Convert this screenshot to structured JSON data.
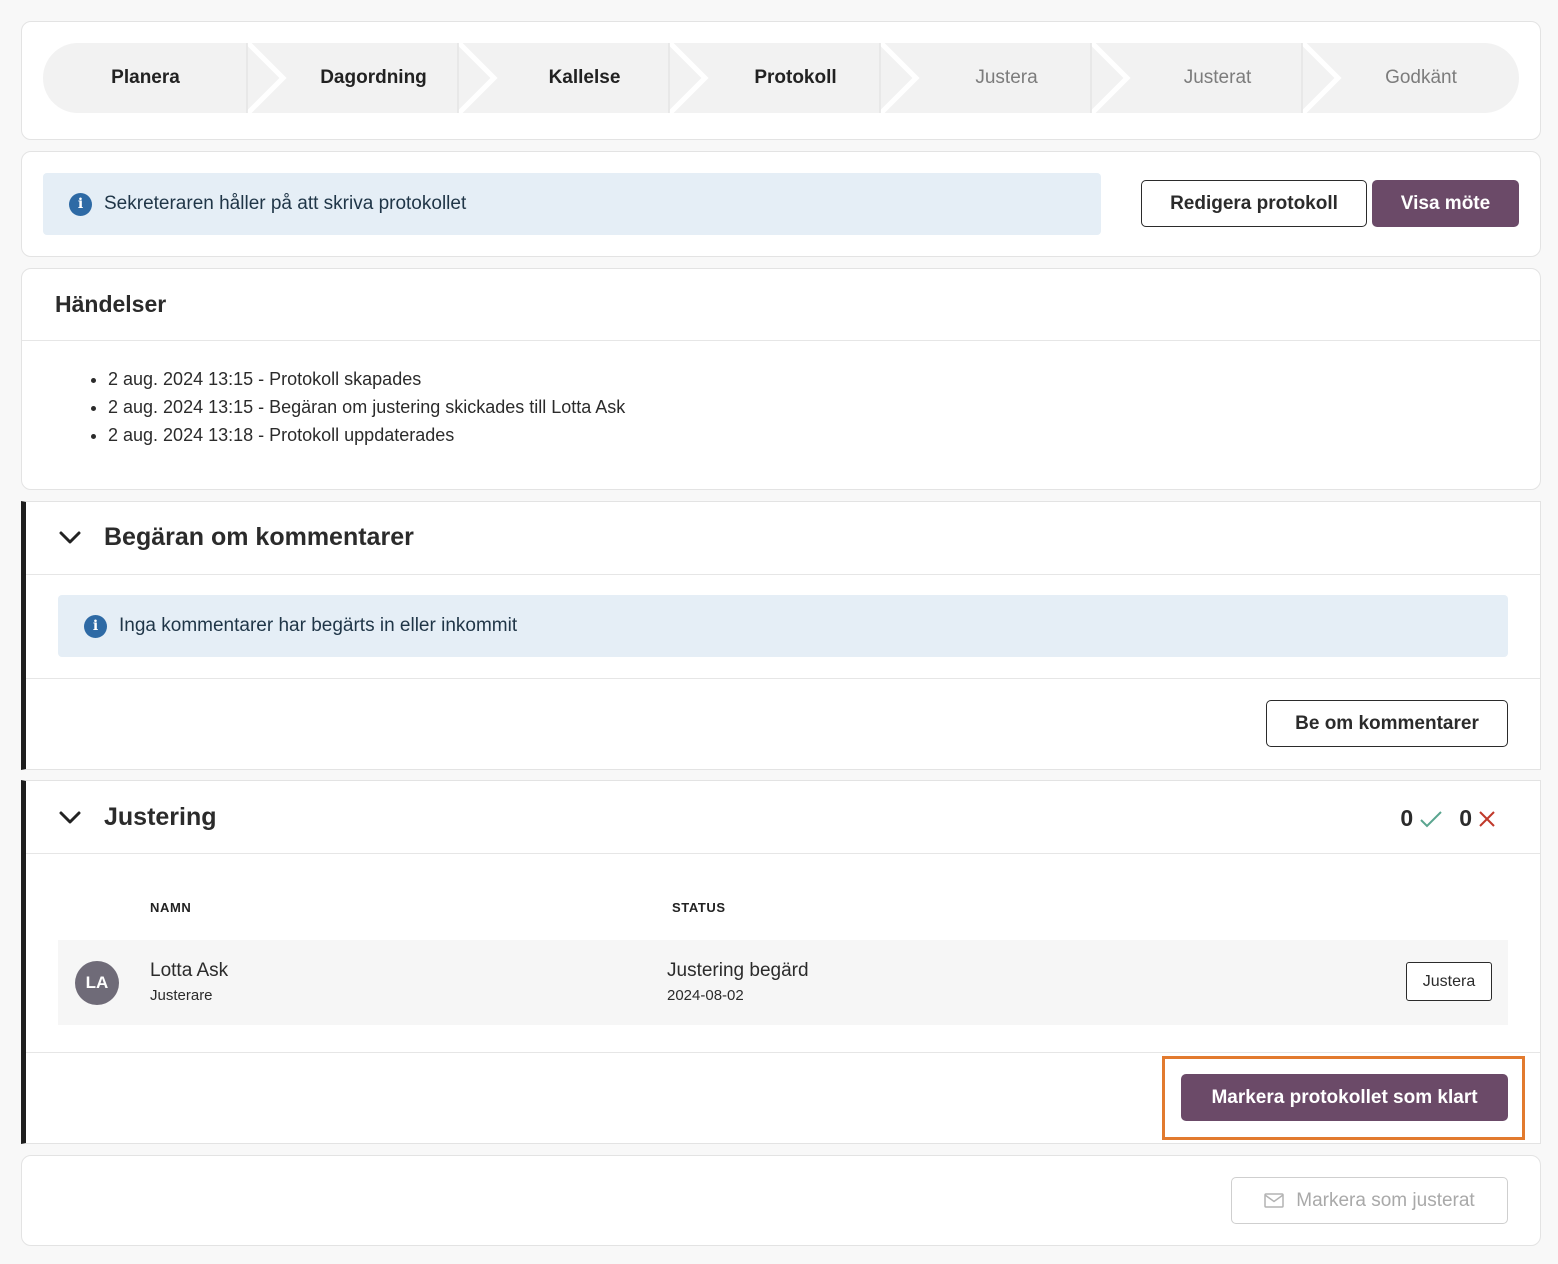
{
  "stepper": {
    "steps": [
      {
        "label": "Planera",
        "state": "done"
      },
      {
        "label": "Dagordning",
        "state": "done"
      },
      {
        "label": "Kallelse",
        "state": "done"
      },
      {
        "label": "Protokoll",
        "state": "current"
      },
      {
        "label": "Justera",
        "state": "future"
      },
      {
        "label": "Justerat",
        "state": "future"
      },
      {
        "label": "Godkänt",
        "state": "future"
      }
    ]
  },
  "status": {
    "info_icon": "info-icon",
    "message": "Sekreteraren håller på att skriva protokollet",
    "edit_button": "Redigera protokoll",
    "view_button": "Visa möte"
  },
  "events": {
    "title": "Händelser",
    "items": [
      "2 aug. 2024 13:15 - Protokoll skapades",
      "2 aug. 2024 13:15 - Begäran om justering skickades till Lotta Ask",
      "2 aug. 2024 13:18 - Protokoll uppdaterades"
    ]
  },
  "comments": {
    "chevron_icon": "chevron-down-icon",
    "title": "Begäran om kommentarer",
    "info_message": "Inga kommentarer har begärts in eller inkommit",
    "request_button": "Be om kommentarer"
  },
  "adjustment": {
    "chevron_icon": "chevron-down-icon",
    "title": "Justering",
    "approved_count": "0",
    "rejected_count": "0",
    "columns": {
      "name": "NAMN",
      "status": "STATUS"
    },
    "rows": [
      {
        "initials": "LA",
        "name": "Lotta Ask",
        "role": "Justerare",
        "status": "Justering begärd",
        "date": "2024-08-02",
        "action": "Justera"
      }
    ],
    "mark_ready_button": "Markera protokollet som klart"
  },
  "footer": {
    "mail_icon": "envelope-icon",
    "mark_adjusted_button": "Markera som justerat"
  },
  "colors": {
    "primary": "#6b4a68",
    "info_bg": "#e5eef6",
    "info_icon": "#2e6aa5",
    "check": "#5aa58f",
    "cross": "#c0392b",
    "highlight": "#e27a2e"
  }
}
